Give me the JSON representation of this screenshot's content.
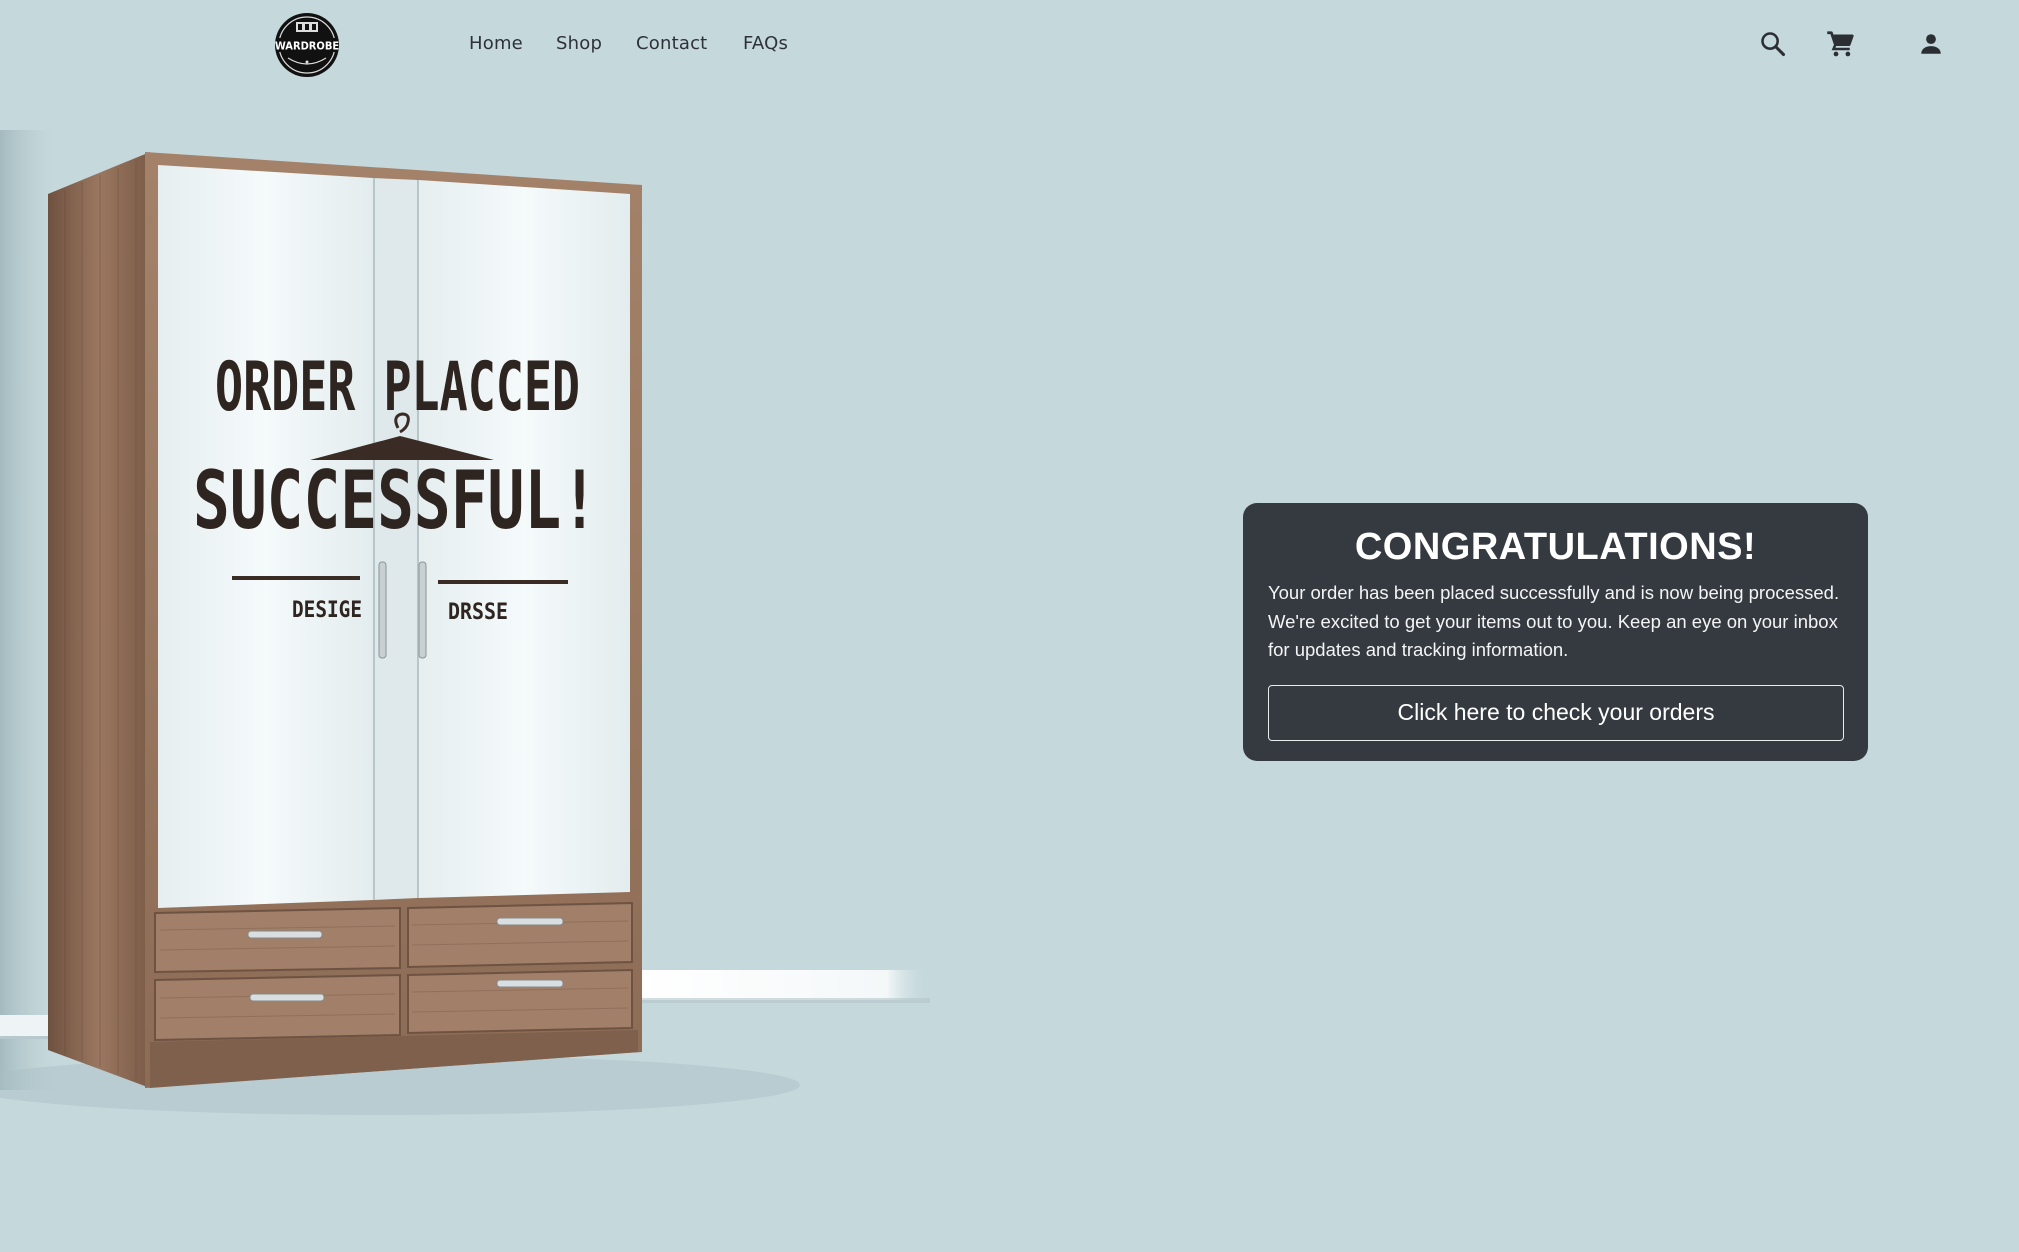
{
  "brand": {
    "logo_text": "WARDROBE",
    "icon": "wardrobe-logo-icon"
  },
  "nav": {
    "links": [
      {
        "label": "Home"
      },
      {
        "label": "Shop"
      },
      {
        "label": "Contact"
      },
      {
        "label": "FAQs"
      }
    ]
  },
  "header_actions": {
    "search_icon": "search-icon",
    "cart_icon": "cart-icon",
    "account_icon": "account-icon"
  },
  "hero": {
    "headline_line1": "ORDER PLACCED",
    "headline_line2": "SUCCESSFUL!",
    "caption_left": "DESIGE",
    "caption_right": "DRSSE"
  },
  "confirmation": {
    "title": "CONGRATULATIONS!",
    "message": "Your order has been placed successfully and is now being processed. We're excited to get your items out to you. Keep an eye on your inbox for updates and tracking information.",
    "button_label": "Click here to check your orders"
  },
  "colors": {
    "background": "#c5d8dc",
    "card_background": "#343a40",
    "nav_text": "#2e3238",
    "wood": "#8b6a52"
  }
}
